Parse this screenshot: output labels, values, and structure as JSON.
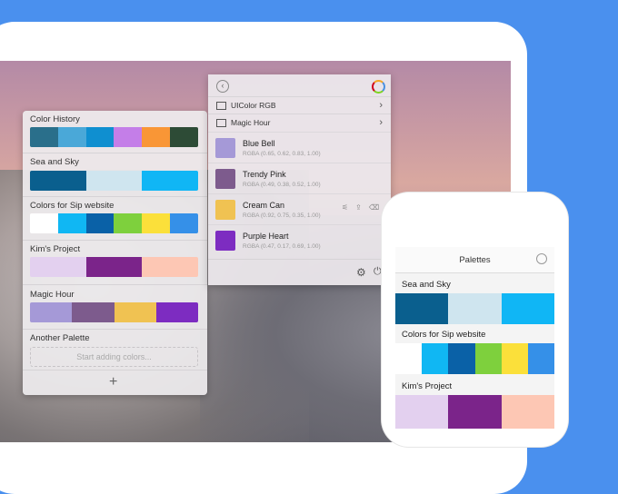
{
  "left_panel": {
    "palettes": [
      {
        "name": "Color History",
        "colors": [
          "#2a6f8b",
          "#4aa8d8",
          "#0f8fd0",
          "#c47ee8",
          "#f99636",
          "#2d4b36"
        ]
      },
      {
        "name": "Sea and Sky",
        "colors": [
          "#0a5f8e",
          "#cfe5ef",
          "#10b6f5"
        ]
      },
      {
        "name": "Colors for Sip website",
        "colors": [
          "#ffffff",
          "#10b7f3",
          "#0a61a7",
          "#7ed03d",
          "#fbe03a",
          "#3590e8"
        ]
      },
      {
        "name": "Kim's Project",
        "colors": [
          "#e3d0ef",
          "#7b248a",
          "#fdc7b4"
        ]
      },
      {
        "name": "Magic Hour",
        "colors": [
          "#a599d7",
          "#7d5b8d",
          "#f0c252",
          "#7d2cc1"
        ]
      }
    ],
    "another_palette": "Another Palette",
    "add_placeholder": "Start adding colors...",
    "add_button": "+"
  },
  "right_panel": {
    "format_label": "UIColor RGB",
    "palette_label": "Magic Hour",
    "colors": [
      {
        "name": "Blue Bell",
        "value": "RGBA (0.65, 0.62, 0.83, 1.00)",
        "hex": "#a599d7"
      },
      {
        "name": "Trendy Pink",
        "value": "RGBA (0.49, 0.38, 0.52, 1.00)",
        "hex": "#7d5b8d"
      },
      {
        "name": "Cream Can",
        "value": "RGBA (0.92, 0.75, 0.35, 1.00)",
        "hex": "#f0c252"
      },
      {
        "name": "Purple Heart",
        "value": "RGBA (0.47, 0.17, 0.69, 1.00)",
        "hex": "#7d2cc1"
      }
    ]
  },
  "phone": {
    "title": "Palettes",
    "palettes": [
      {
        "name": "Sea and Sky",
        "colors": [
          "#0a5f8e",
          "#cfe5ef",
          "#10b6f5"
        ]
      },
      {
        "name": "Colors for Sip website",
        "colors": [
          "#ffffff",
          "#10b7f3",
          "#0a61a7",
          "#7ed03d",
          "#fbe03a",
          "#3590e8"
        ]
      },
      {
        "name": "Kim's Project",
        "colors": [
          "#e3d0ef",
          "#7b248a",
          "#fdc7b4"
        ]
      }
    ]
  }
}
